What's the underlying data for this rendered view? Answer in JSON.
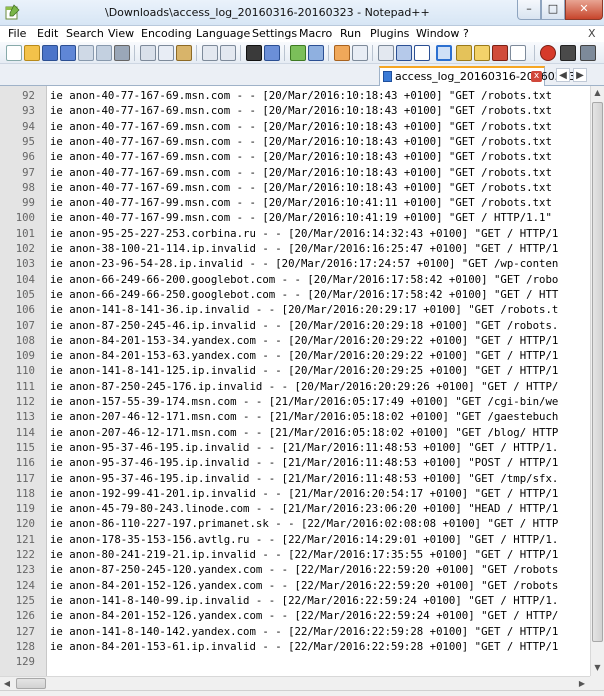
{
  "window": {
    "title": "\\Downloads\\access_log_20160316-20160323 - Notepad++",
    "controls": {
      "minimize": "–",
      "maximize": "□",
      "close": "✕"
    }
  },
  "menu": [
    "File",
    "Edit",
    "Search",
    "View",
    "Encoding",
    "Language",
    "Settings",
    "Macro",
    "Run",
    "Plugins",
    "Window",
    "?"
  ],
  "menu_close_glyph": "X",
  "tab": {
    "label": "access_log_20160316-20160323",
    "close": "x"
  },
  "tab_arrows": {
    "left": "◀",
    "right": "▶"
  },
  "scroll_arrows": {
    "up": "▲",
    "down": "▼",
    "left": "◀",
    "right": "▶"
  },
  "lines": [
    {
      "n": "92",
      "text": "ie anon-40-77-167-69.msn.com - - [20/Mar/2016:10:18:43 +0100] \"GET /robots.txt"
    },
    {
      "n": "93",
      "text": "ie anon-40-77-167-69.msn.com - - [20/Mar/2016:10:18:43 +0100] \"GET /robots.txt"
    },
    {
      "n": "94",
      "text": "ie anon-40-77-167-69.msn.com - - [20/Mar/2016:10:18:43 +0100] \"GET /robots.txt"
    },
    {
      "n": "95",
      "text": "ie anon-40-77-167-69.msn.com - - [20/Mar/2016:10:18:43 +0100] \"GET /robots.txt"
    },
    {
      "n": "96",
      "text": "ie anon-40-77-167-69.msn.com - - [20/Mar/2016:10:18:43 +0100] \"GET /robots.txt"
    },
    {
      "n": "97",
      "text": "ie anon-40-77-167-69.msn.com - - [20/Mar/2016:10:18:43 +0100] \"GET /robots.txt"
    },
    {
      "n": "98",
      "text": "ie anon-40-77-167-69.msn.com - - [20/Mar/2016:10:18:43 +0100] \"GET /robots.txt"
    },
    {
      "n": "99",
      "text": "ie anon-40-77-167-99.msn.com - - [20/Mar/2016:10:41:11 +0100] \"GET /robots.txt"
    },
    {
      "n": "100",
      "text": "ie anon-40-77-167-99.msn.com - - [20/Mar/2016:10:41:19 +0100] \"GET / HTTP/1.1\""
    },
    {
      "n": "101",
      "text": "ie anon-95-25-227-253.corbina.ru - - [20/Mar/2016:14:32:43 +0100] \"GET / HTTP/1"
    },
    {
      "n": "102",
      "text": "ie anon-38-100-21-114.ip.invalid - - [20/Mar/2016:16:25:47 +0100] \"GET / HTTP/1"
    },
    {
      "n": "103",
      "text": "ie anon-23-96-54-28.ip.invalid - - [20/Mar/2016:17:24:57 +0100] \"GET /wp-conten"
    },
    {
      "n": "104",
      "text": "ie anon-66-249-66-200.googlebot.com - - [20/Mar/2016:17:58:42 +0100] \"GET /robo"
    },
    {
      "n": "105",
      "text": "ie anon-66-249-66-250.googlebot.com - - [20/Mar/2016:17:58:42 +0100] \"GET / HTT"
    },
    {
      "n": "106",
      "text": "ie anon-141-8-141-36.ip.invalid - - [20/Mar/2016:20:29:17 +0100] \"GET /robots.t"
    },
    {
      "n": "107",
      "text": "ie anon-87-250-245-46.ip.invalid - - [20/Mar/2016:20:29:18 +0100] \"GET /robots."
    },
    {
      "n": "108",
      "text": "ie anon-84-201-153-34.yandex.com - - [20/Mar/2016:20:29:22 +0100] \"GET / HTTP/1"
    },
    {
      "n": "109",
      "text": "ie anon-84-201-153-63.yandex.com - - [20/Mar/2016:20:29:22 +0100] \"GET / HTTP/1"
    },
    {
      "n": "110",
      "text": "ie anon-141-8-141-125.ip.invalid - - [20/Mar/2016:20:29:25 +0100] \"GET / HTTP/1"
    },
    {
      "n": "111",
      "text": "ie anon-87-250-245-176.ip.invalid - - [20/Mar/2016:20:29:26 +0100] \"GET / HTTP/"
    },
    {
      "n": "112",
      "text": "ie anon-157-55-39-174.msn.com - - [21/Mar/2016:05:17:49 +0100] \"GET /cgi-bin/we"
    },
    {
      "n": "113",
      "text": "ie anon-207-46-12-171.msn.com - - [21/Mar/2016:05:18:02 +0100] \"GET /gaestebuch"
    },
    {
      "n": "114",
      "text": "ie anon-207-46-12-171.msn.com - - [21/Mar/2016:05:18:02 +0100] \"GET /blog/ HTTP"
    },
    {
      "n": "115",
      "text": "ie anon-95-37-46-195.ip.invalid - - [21/Mar/2016:11:48:53 +0100] \"GET / HTTP/1."
    },
    {
      "n": "116",
      "text": "ie anon-95-37-46-195.ip.invalid - - [21/Mar/2016:11:48:53 +0100] \"POST / HTTP/1"
    },
    {
      "n": "117",
      "text": "ie anon-95-37-46-195.ip.invalid - - [21/Mar/2016:11:48:53 +0100] \"GET /tmp/sfx."
    },
    {
      "n": "118",
      "text": "ie anon-192-99-41-201.ip.invalid - - [21/Mar/2016:20:54:17 +0100] \"GET / HTTP/1"
    },
    {
      "n": "119",
      "text": "ie anon-45-79-80-243.linode.com - - [21/Mar/2016:23:06:20 +0100] \"HEAD / HTTP/1"
    },
    {
      "n": "120",
      "text": "ie anon-86-110-227-197.primanet.sk - - [22/Mar/2016:02:08:08 +0100] \"GET / HTTP"
    },
    {
      "n": "121",
      "text": "ie anon-178-35-153-156.avtlg.ru - - [22/Mar/2016:14:29:01 +0100] \"GET / HTTP/1."
    },
    {
      "n": "122",
      "text": "ie anon-80-241-219-21.ip.invalid - - [22/Mar/2016:17:35:55 +0100] \"GET / HTTP/1"
    },
    {
      "n": "123",
      "text": "ie anon-87-250-245-120.yandex.com - - [22/Mar/2016:22:59:20 +0100] \"GET /robots"
    },
    {
      "n": "124",
      "text": "ie anon-84-201-152-126.yandex.com - - [22/Mar/2016:22:59:20 +0100] \"GET /robots"
    },
    {
      "n": "125",
      "text": "ie anon-141-8-140-99.ip.invalid - - [22/Mar/2016:22:59:24 +0100] \"GET / HTTP/1."
    },
    {
      "n": "126",
      "text": "ie anon-84-201-152-126.yandex.com - - [22/Mar/2016:22:59:24 +0100] \"GET / HTTP/"
    },
    {
      "n": "127",
      "text": "ie anon-141-8-140-142.yandex.com - - [22/Mar/2016:22:59:28 +0100] \"GET / HTTP/1"
    },
    {
      "n": "128",
      "text": "ie anon-84-201-153-61.ip.invalid - - [22/Mar/2016:22:59:28 +0100] \"GET / HTTP/1"
    },
    {
      "n": "129",
      "text": ""
    }
  ],
  "toolbar_icons": [
    "new-file-icon",
    "open-file-icon",
    "save-icon",
    "save-all-icon",
    "close-icon",
    "close-all-icon",
    "print-icon",
    "cut-icon",
    "copy-icon",
    "paste-icon",
    "undo-icon",
    "redo-icon",
    "find-icon",
    "replace-icon",
    "zoom-in-icon",
    "zoom-out-icon",
    "sync-v-icon",
    "sync-h-icon",
    "word-wrap-icon",
    "show-all-chars-icon",
    "indent-guide-icon",
    "doc-map-icon",
    "function-list-icon",
    "folder-workspace-icon",
    "monitor-icon",
    "record-macro-icon",
    "stop-macro-icon",
    "play-macro-icon"
  ],
  "colors": {
    "accent": "#f6a623",
    "gutter": "#e4e4e4",
    "titlebar": "#d7e6f5"
  }
}
